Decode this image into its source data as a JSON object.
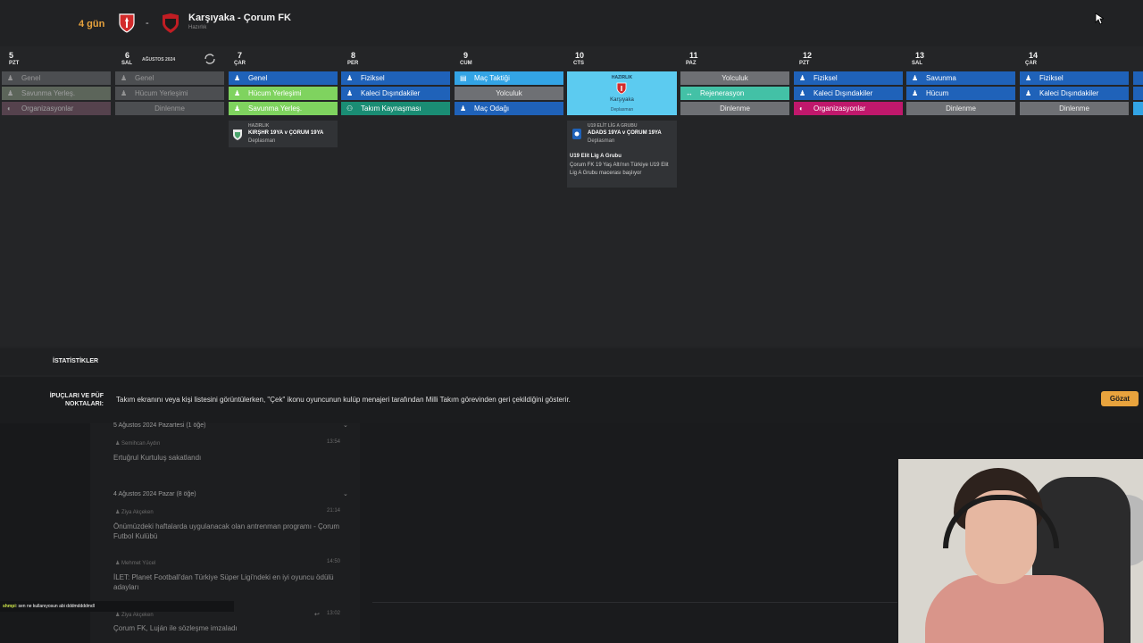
{
  "header": {
    "countdown": "4 gün",
    "match_title": "Karşıyaka - Çorum FK",
    "match_subtitle": "Hazırlık",
    "separator": "-",
    "home_crest_icon": "karsiyaka-crest-icon",
    "away_crest_icon": "corum-crest-icon"
  },
  "calendar": {
    "month_label": "AĞUSTOS 2024",
    "days": [
      {
        "num": "5",
        "name": "PZT"
      },
      {
        "num": "6",
        "name": "SAL"
      },
      {
        "num": "7",
        "name": "ÇAR"
      },
      {
        "num": "8",
        "name": "PER"
      },
      {
        "num": "9",
        "name": "CUM"
      },
      {
        "num": "10",
        "name": "CTS"
      },
      {
        "num": "11",
        "name": "PAZ"
      },
      {
        "num": "12",
        "name": "PZT"
      },
      {
        "num": "13",
        "name": "SAL"
      },
      {
        "num": "14",
        "name": "ÇAR"
      }
    ],
    "sessions": {
      "d5": [
        "Genel",
        "Savunma Yerleş.",
        "Organizasyonlar"
      ],
      "d6": [
        "Genel",
        "Hücum Yerleşimi",
        "Dinlenme"
      ],
      "d7": [
        "Genel",
        "Hücum Yerleşimi",
        "Savunma Yerleş."
      ],
      "d8": [
        "Fiziksel",
        "Kaleci Dışındakiler",
        "Takım Kaynaşması"
      ],
      "d9": [
        "Maç Taktiği",
        "Yolculuk",
        "Maç Odağı"
      ],
      "d11": [
        "Yolculuk",
        "Rejenerasyon",
        "Dinlenme"
      ],
      "d12": [
        "Fiziksel",
        "Kaleci Dışındakiler",
        "Organizasyonlar"
      ],
      "d13": [
        "Savunma",
        "Hücum",
        "Dinlenme"
      ],
      "d14": [
        "Fiziksel",
        "Kaleci Dışındakiler",
        "Dinlenme"
      ]
    },
    "match_d7": {
      "competition": "HAZIRLIK",
      "title": "KIRŞHR 19YA v ÇORUM 19YA",
      "venue": "Deplasman"
    },
    "match_d10": {
      "competition": "HAZIRLIK",
      "team": "Karşıyaka",
      "venue": "Deplasman"
    },
    "match_d10_u19": {
      "competition": "U19 ELİT LİG A GRUBU",
      "title": "ADADS 19YA v ÇORUM 19YA",
      "venue": "Deplasman"
    },
    "event_note": {
      "title": "U19 Elit Lig A Grubu",
      "body": "Çorum FK 19 Yaş Altı'nın Türkiye U19 Elit Lig A Grubu macerası başlıyor"
    }
  },
  "stats": {
    "label": "İSTATİSTİKLER"
  },
  "tips": {
    "label": "İPUÇLARI VE PÜF NOKTALARI:",
    "text": "Takım ekranını veya kişi listesini görüntülerken, \"Çek\" ikonu oyuncunun kulüp menajeri tarafından Milli Takım görevinden geri çekildiğini gösterir.",
    "button": "Gözat"
  },
  "inbox": {
    "groups": [
      {
        "title": "5 Ağustos 2024 Pazartesi (1 öğe)"
      },
      {
        "title": "4 Ağustos 2024 Pazar (8 öğe)"
      }
    ],
    "items": [
      {
        "sender": "Semihcan Aydın",
        "time": "13:54",
        "subject": "Ertuğrul Kurtuluş sakatlandı"
      },
      {
        "sender": "Ziya Akçeken",
        "time": "21:14",
        "subject": "Önümüzdeki haftalarda uygulanacak olan antrenman programı - Çorum Futbol Kulübü"
      },
      {
        "sender": "Mehmet Yücel",
        "time": "14:50",
        "subject": "İLET: Planet Football'dan Türkiye Süper Ligi'ndeki en iyi oyuncu ödülü adayları"
      },
      {
        "sender": "Ziya Akçeken",
        "time": "13:02",
        "subject": "Çorum FK, Luján ile sözleşme imzaladı"
      }
    ]
  },
  "chat": {
    "user": "shmpi",
    "message": ": sen ne kullanıyosun abi dddmddddmdl"
  },
  "colors": {
    "accent": "#e8a33d",
    "session_blue": "#1f62b9",
    "session_green": "#7fd35f",
    "session_grey": "#6e7074",
    "session_magenta": "#c0186c",
    "match_highlight": "#5ccbf0"
  }
}
